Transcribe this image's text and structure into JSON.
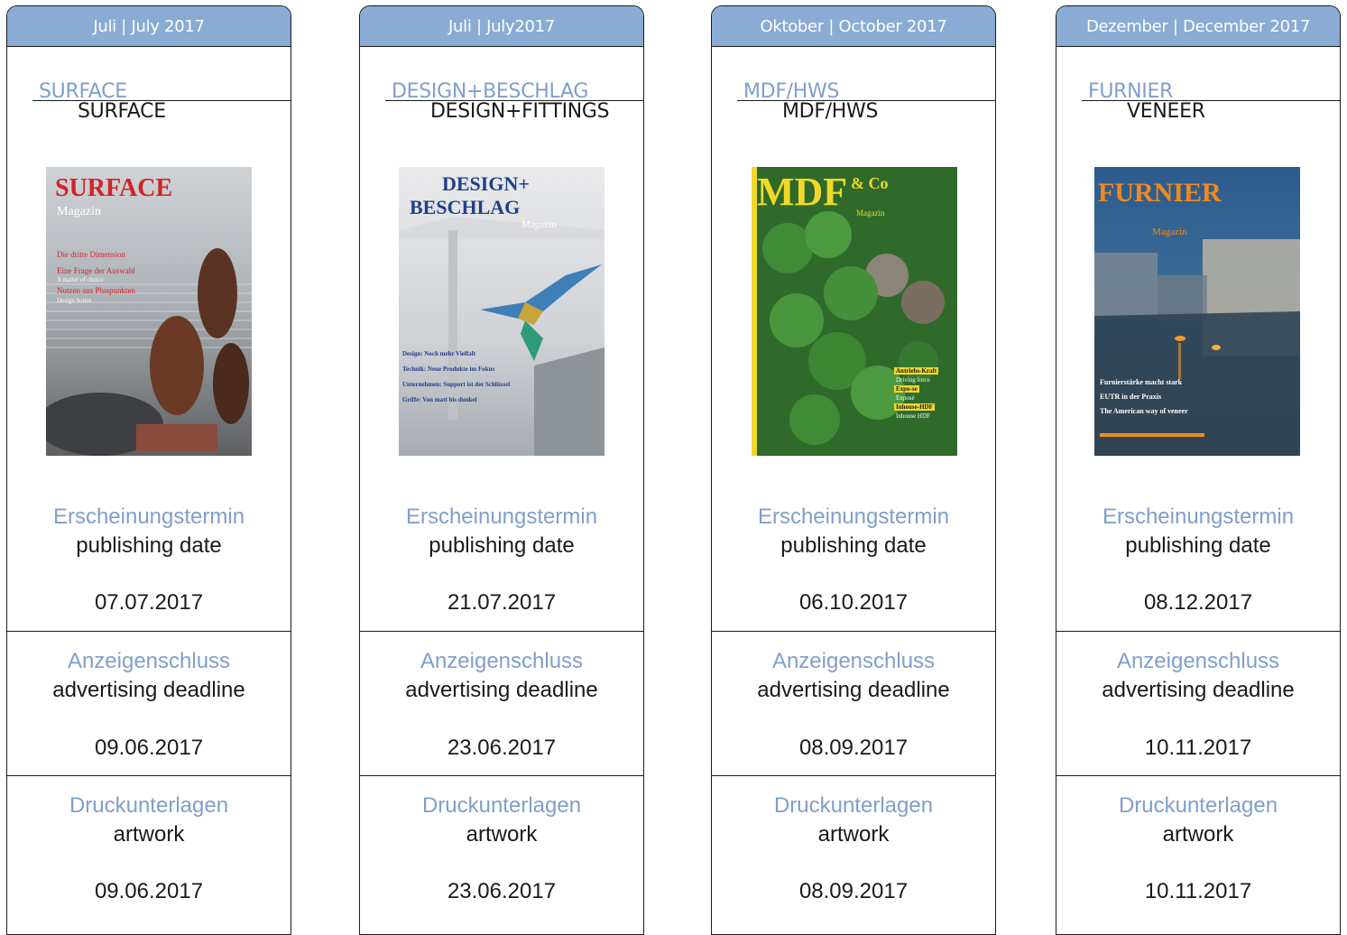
{
  "columns": [
    {
      "header": "Juli | July 2017",
      "title_de": "SURFACE",
      "title_en": "SURFACE",
      "cover": {
        "title": "SURFACE",
        "subtitle": "Magazin",
        "lines": [
          "Die dritte Dimension",
          "Eine Frage der Auswahl",
          "A matter of choice",
          "Nutzen aus Pluspunkten",
          "Design bonus"
        ]
      },
      "publishing": {
        "label_de": "Erscheinungstermin",
        "label_en": "publishing date",
        "date": "07.07.2017"
      },
      "advertising": {
        "label_de": "Anzeigenschluss",
        "label_en": "advertising deadline",
        "date": "09.06.2017"
      },
      "artwork": {
        "label_de": "Druckunterlagen",
        "label_en": "artwork",
        "date": "09.06.2017"
      }
    },
    {
      "header": "Juli | July2017",
      "title_de": "DESIGN+BESCHLAG",
      "title_en": "DESIGN+FITTINGS",
      "cover": {
        "title": "DESIGN+",
        "title2": "BESCHLAG",
        "subtitle": "Magazin",
        "lines": [
          "Design: Noch mehr Vielfalt",
          "Technik: Neue Produkte im Fokus",
          "Unternehmen: Support ist der Schlüssel",
          "Griffe: Von matt bis dunkel"
        ]
      },
      "publishing": {
        "label_de": "Erscheinungstermin",
        "label_en": "publishing date",
        "date": "21.07.2017"
      },
      "advertising": {
        "label_de": "Anzeigenschluss",
        "label_en": "advertising deadline",
        "date": "23.06.2017"
      },
      "artwork": {
        "label_de": "Druckunterlagen",
        "label_en": "artwork",
        "date": "23.06.2017"
      }
    },
    {
      "header": "Oktober | October 2017",
      "title_de": "MDF/HWS",
      "title_en": "MDF/HWS",
      "cover": {
        "title": "MDF",
        "title2": "& Co",
        "subtitle": "Magazin",
        "lines": [
          "Antriebs-Kraft",
          "Driving force",
          "Expo-se",
          "Exposé",
          "Inhouse-HDF",
          "Inhouse HDF"
        ]
      },
      "publishing": {
        "label_de": "Erscheinungstermin",
        "label_en": "publishing date",
        "date": "06.10.2017"
      },
      "advertising": {
        "label_de": "Anzeigenschluss",
        "label_en": "advertising deadline",
        "date": "08.09.2017"
      },
      "artwork": {
        "label_de": "Druckunterlagen",
        "label_en": "artwork",
        "date": "08.09.2017"
      }
    },
    {
      "header": "Dezember | December 2017",
      "title_de": "FURNIER",
      "title_en": "VENEER",
      "cover": {
        "title": "FURNIER",
        "subtitle": "Magazin",
        "lines": [
          "Furnierstärke macht stark",
          "EUTR in der Praxis",
          "The American way of veneer"
        ]
      },
      "publishing": {
        "label_de": "Erscheinungstermin",
        "label_en": "publishing date",
        "date": "08.12.2017"
      },
      "advertising": {
        "label_de": "Anzeigenschluss",
        "label_en": "advertising deadline",
        "date": "10.11.2017"
      },
      "artwork": {
        "label_de": "Druckunterlagen",
        "label_en": "artwork",
        "date": "10.11.2017"
      }
    }
  ],
  "colors": {
    "header_bg": "#8aabd4",
    "accent_text": "#7f9fcb",
    "border": "#1a1a1a"
  }
}
